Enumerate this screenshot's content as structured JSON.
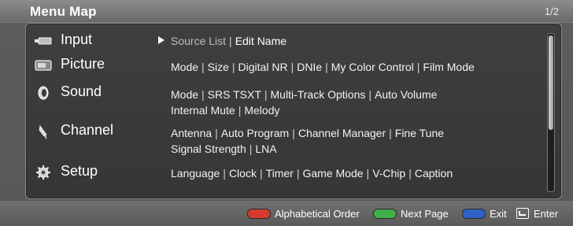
{
  "header": {
    "title": "Menu Map",
    "pager": "1/2"
  },
  "menu": [
    {
      "key": "input",
      "label": "Input",
      "icon": "input-icon",
      "selected": true,
      "items": [
        "Source List",
        "Edit Name"
      ]
    },
    {
      "key": "picture",
      "label": "Picture",
      "icon": "picture-icon",
      "items": [
        "Mode",
        "Size",
        "Digital NR",
        "DNIe",
        "My Color Control",
        "Film Mode"
      ]
    },
    {
      "key": "sound",
      "label": "Sound",
      "icon": "sound-icon",
      "items_line1": [
        "Mode",
        "SRS TSXT",
        "Multi-Track Options",
        "Auto Volume"
      ],
      "items_line2": [
        "Internal Mute",
        "Melody"
      ]
    },
    {
      "key": "channel",
      "label": "Channel",
      "icon": "channel-icon",
      "items_line1": [
        "Antenna",
        "Auto Program",
        "Channel Manager",
        "Fine Tune"
      ],
      "items_line2": [
        "Signal Strength",
        "LNA"
      ]
    },
    {
      "key": "setup",
      "label": "Setup",
      "icon": "setup-icon",
      "items": [
        "Language",
        "Clock",
        "Timer",
        "Game Mode",
        "V-Chip",
        "Caption"
      ]
    }
  ],
  "footer": {
    "alpha": {
      "label": "Alphabetical Order",
      "color": "#d63a2e"
    },
    "next": {
      "label": "Next Page",
      "color": "#3fb04a"
    },
    "exit": {
      "label": "Exit",
      "color": "#2f62c9"
    },
    "enter": {
      "label": "Enter"
    }
  }
}
